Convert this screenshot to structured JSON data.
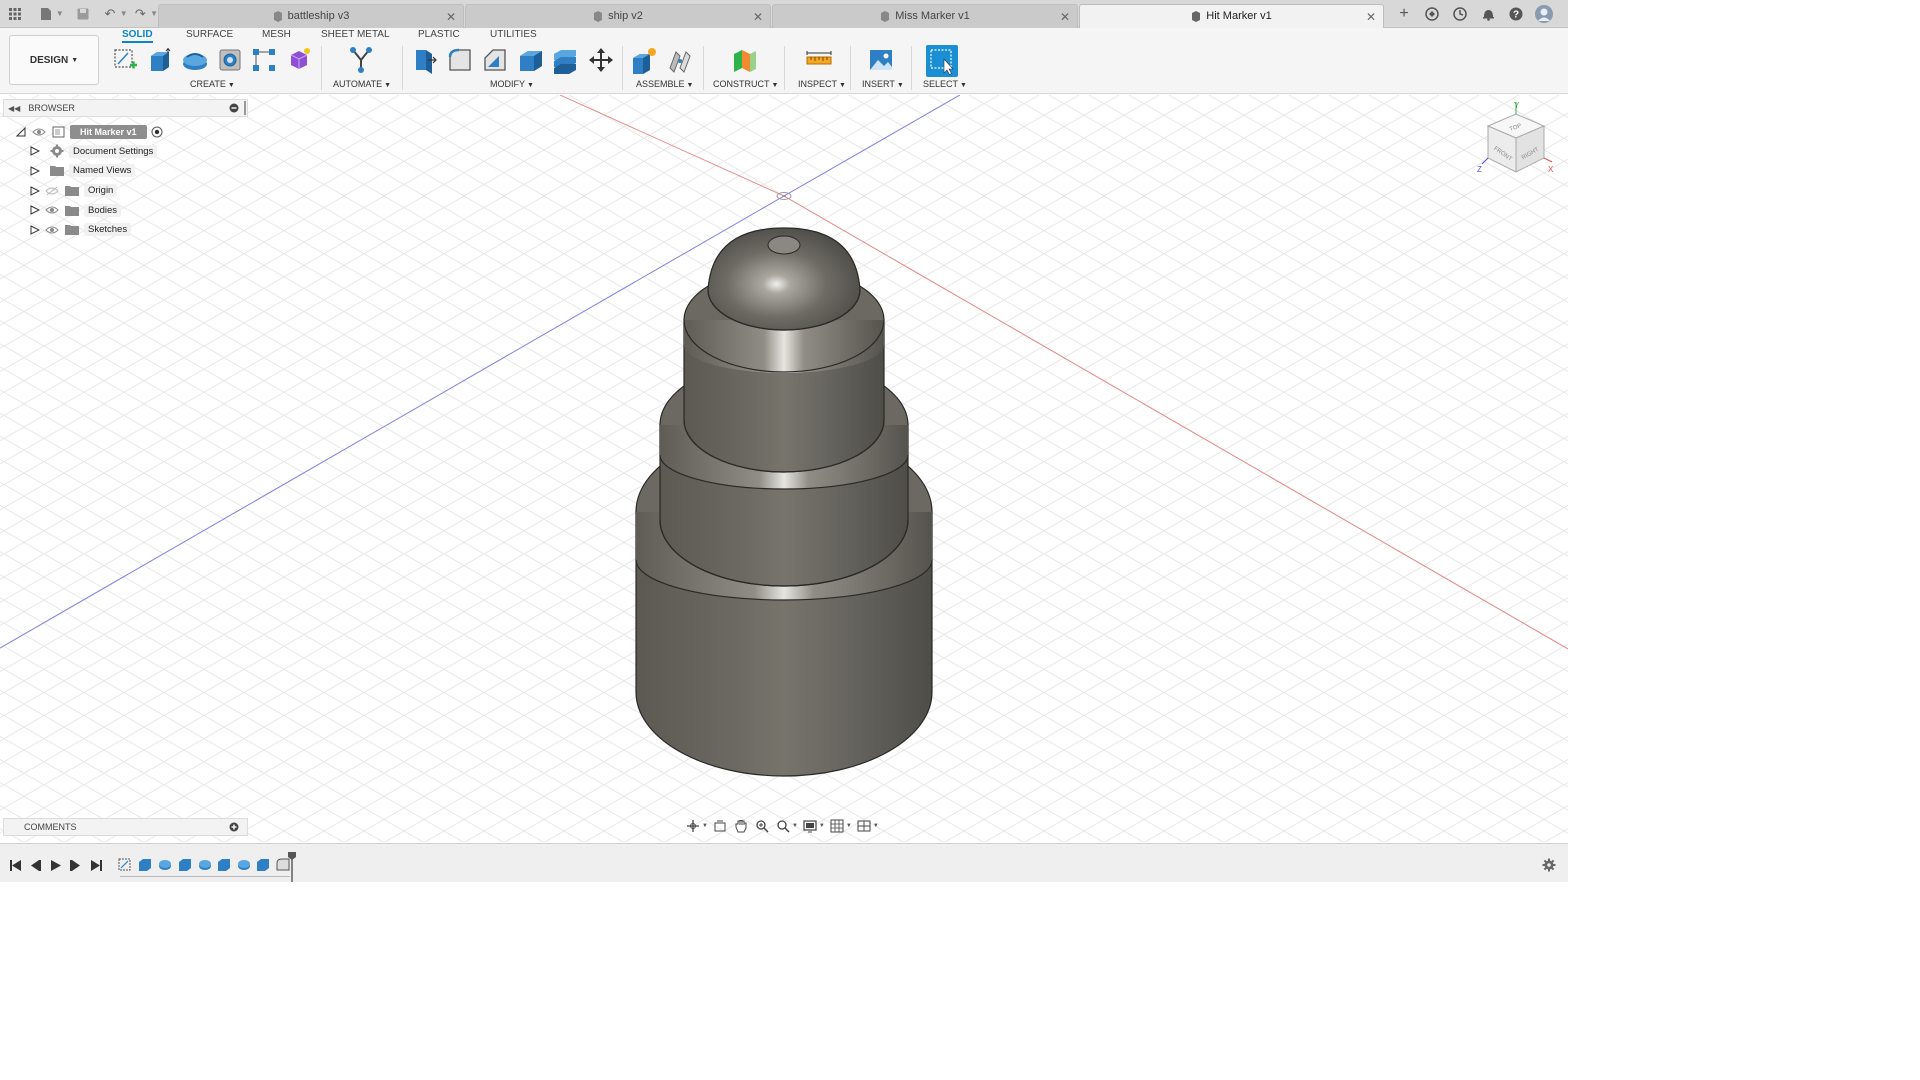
{
  "tabs": [
    {
      "label": "battleship v3",
      "active": false
    },
    {
      "label": "ship v2",
      "active": false
    },
    {
      "label": "Miss Marker v1",
      "active": false
    },
    {
      "label": "Hit Marker v1",
      "active": true
    }
  ],
  "toolbar": {
    "design_label": "DESIGN",
    "workspace_tabs": [
      "SOLID",
      "SURFACE",
      "MESH",
      "SHEET METAL",
      "PLASTIC",
      "UTILITIES"
    ],
    "active_workspace": "SOLID",
    "groups": {
      "create": "CREATE",
      "automate": "AUTOMATE",
      "modify": "MODIFY",
      "assemble": "ASSEMBLE",
      "construct": "CONSTRUCT",
      "inspect": "INSPECT",
      "insert": "INSERT",
      "select": "SELECT"
    }
  },
  "browser": {
    "title": "BROWSER",
    "root": "Hit Marker v1",
    "items": [
      {
        "label": "Document Settings",
        "icon": "gear-icon"
      },
      {
        "label": "Named Views",
        "icon": "folder-icon"
      },
      {
        "label": "Origin",
        "icon": "folder-icon",
        "hidden": true
      },
      {
        "label": "Bodies",
        "icon": "folder-icon"
      },
      {
        "label": "Sketches",
        "icon": "folder-icon"
      }
    ]
  },
  "comments": {
    "title": "COMMENTS"
  },
  "viewcube": {
    "top": "TOP",
    "front": "FRONT",
    "right": "RIGHT",
    "axis_x": "X",
    "axis_y": "Y",
    "axis_z": "Z"
  },
  "colors": {
    "accent": "#0a86c8",
    "body": "#6e6b63",
    "grid": "#e4e4e4",
    "axis_red": "#e06060",
    "axis_blue": "#6f6fe0"
  }
}
